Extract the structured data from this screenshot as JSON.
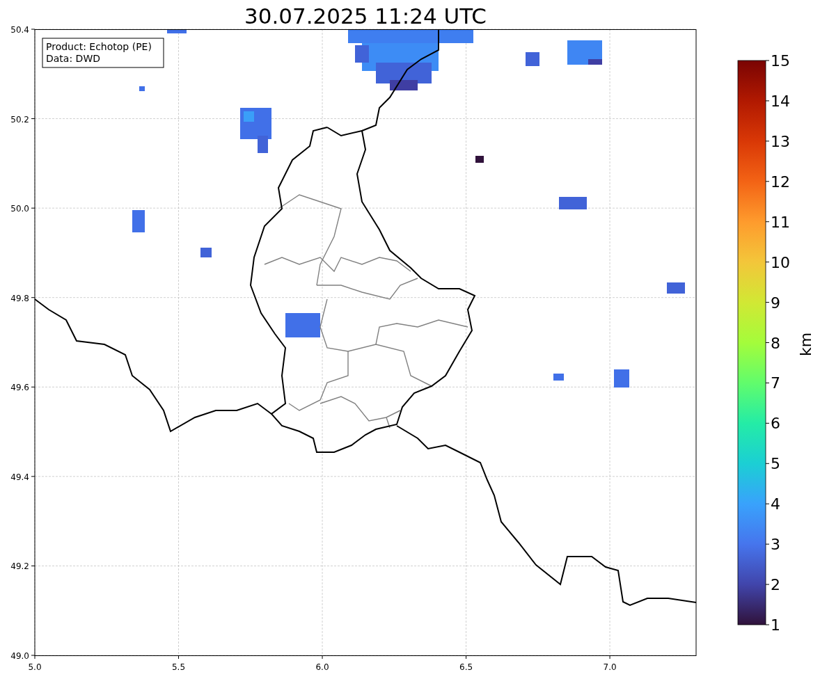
{
  "title": "30.07.2025 11:24 UTC",
  "info_box": [
    "Product: Echotop (PE)",
    "Data: DWD"
  ],
  "x_axis": {
    "ticks": [
      "5.0",
      "5.5",
      "6.0",
      "6.5",
      "7.0"
    ]
  },
  "y_axis": {
    "ticks": [
      "50.4",
      "50.2",
      "50.0",
      "49.8",
      "49.6",
      "49.4",
      "49.2",
      "49.0"
    ]
  },
  "colorbar": {
    "label": "km",
    "ticks": [
      "15",
      "14",
      "13",
      "12",
      "11",
      "10",
      "9",
      "8",
      "7",
      "6",
      "5",
      "4",
      "3",
      "2",
      "1"
    ]
  }
}
